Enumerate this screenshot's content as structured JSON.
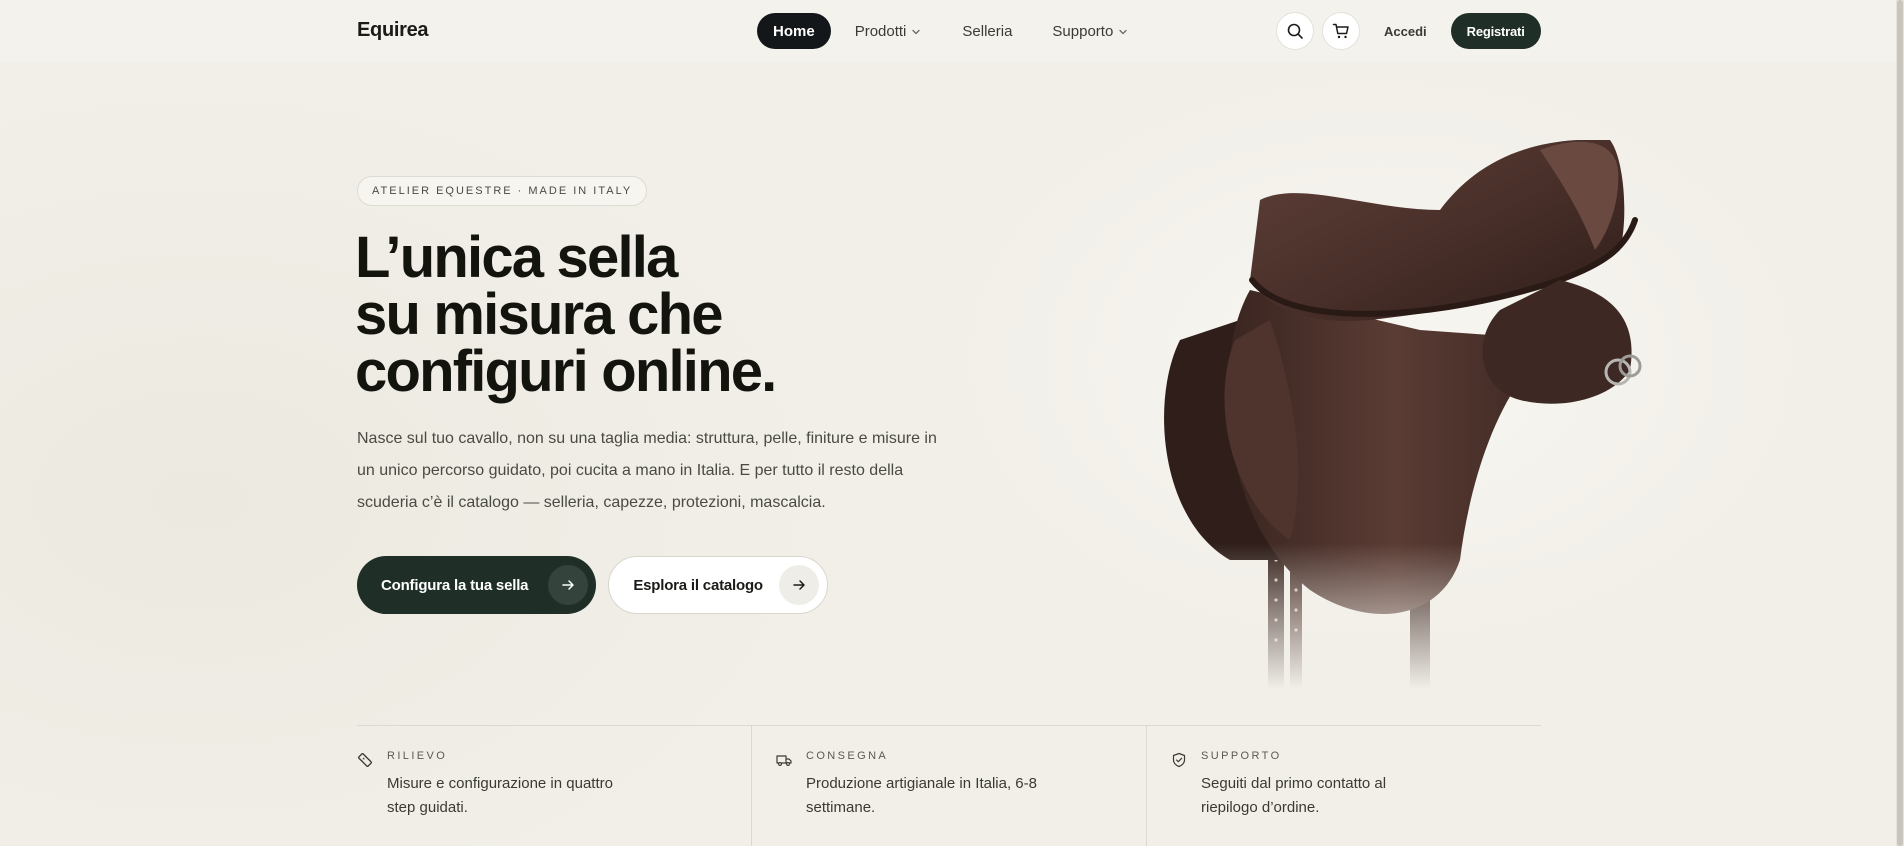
{
  "brand": {
    "name": "Equirea",
    "accent": "#1f2e27",
    "nav_active_bg": "#14171a"
  },
  "nav": {
    "items": [
      {
        "label": "Home",
        "active": true,
        "has_dropdown": false
      },
      {
        "label": "Prodotti",
        "active": false,
        "has_dropdown": true
      },
      {
        "label": "Selleria",
        "active": false,
        "has_dropdown": false
      },
      {
        "label": "Supporto",
        "active": false,
        "has_dropdown": true
      }
    ]
  },
  "header_actions": {
    "search_icon": "search-icon",
    "cart_icon": "cart-icon",
    "login_label": "Accedi",
    "register_label": "Registrati"
  },
  "hero": {
    "eyebrow": "ATELIER EQUESTRE · MADE IN ITALY",
    "headline_lines": [
      "L’unica sella",
      "su misura che",
      "configuri online."
    ],
    "lead": "Nasce sul tuo cavallo, non su una taglia media: struttura, pelle, finiture e misure in un unico percorso guidato, poi cucita a mano in Italia. E per tutto il resto della scuderia c’è il catalogo — selleria, capezze, protezioni, mascalcia.",
    "cta_primary": "Configura la tua sella",
    "cta_secondary": "Esplora il catalogo",
    "image": "saddle-image"
  },
  "features": [
    {
      "icon": "ruler-icon",
      "label": "RILIEVO",
      "text": "Misure e configurazione in quattro step guidati."
    },
    {
      "icon": "truck-icon",
      "label": "CONSEGNA",
      "text": "Produzione artigianale in Italia, 6-8 settimane."
    },
    {
      "icon": "shield-check-icon",
      "label": "SUPPORTO",
      "text": "Seguiti dal primo contatto al riepilogo d’ordine."
    }
  ]
}
